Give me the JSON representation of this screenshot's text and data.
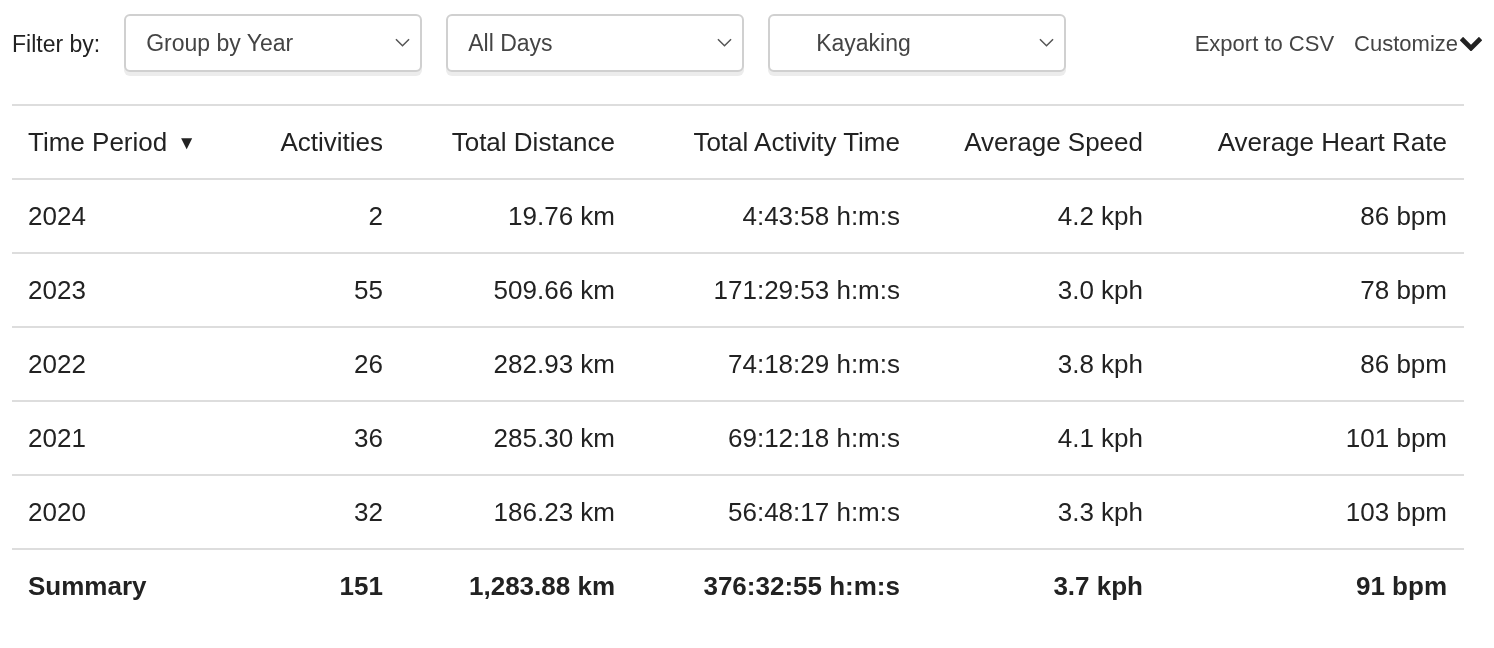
{
  "filter_bar": {
    "label": "Filter by:",
    "dropdowns": [
      {
        "value": "Group by Year"
      },
      {
        "value": "All Days"
      },
      {
        "value": "Kayaking"
      }
    ],
    "links": [
      "Export to CSV",
      "Customize"
    ]
  },
  "table": {
    "columns": [
      {
        "label": "Time Period",
        "sort_indicator": "▼"
      },
      {
        "label": "Activities"
      },
      {
        "label": "Total Distance"
      },
      {
        "label": "Total Activity Time"
      },
      {
        "label": "Average Speed"
      },
      {
        "label": "Average Heart Rate"
      }
    ],
    "rows": [
      {
        "kind": "data",
        "cells": [
          "2024",
          "2",
          "19.76 km",
          "4:43:58 h:m:s",
          "4.2 kph",
          "86 bpm"
        ]
      },
      {
        "kind": "data",
        "cells": [
          "2023",
          "55",
          "509.66 km",
          "171:29:53 h:m:s",
          "3.0 kph",
          "78 bpm"
        ]
      },
      {
        "kind": "data",
        "cells": [
          "2022",
          "26",
          "282.93 km",
          "74:18:29 h:m:s",
          "3.8 kph",
          "86 bpm"
        ]
      },
      {
        "kind": "data",
        "cells": [
          "2021",
          "36",
          "285.30 km",
          "69:12:18 h:m:s",
          "4.1 kph",
          "101 bpm"
        ]
      },
      {
        "kind": "data",
        "cells": [
          "2020",
          "32",
          "186.23 km",
          "56:48:17 h:m:s",
          "3.3 kph",
          "103 bpm"
        ]
      },
      {
        "kind": "summary",
        "cells": [
          "Summary",
          "151",
          "1,283.88 km",
          "376:32:55 h:m:s",
          "3.7 kph",
          "91 bpm"
        ]
      }
    ]
  }
}
